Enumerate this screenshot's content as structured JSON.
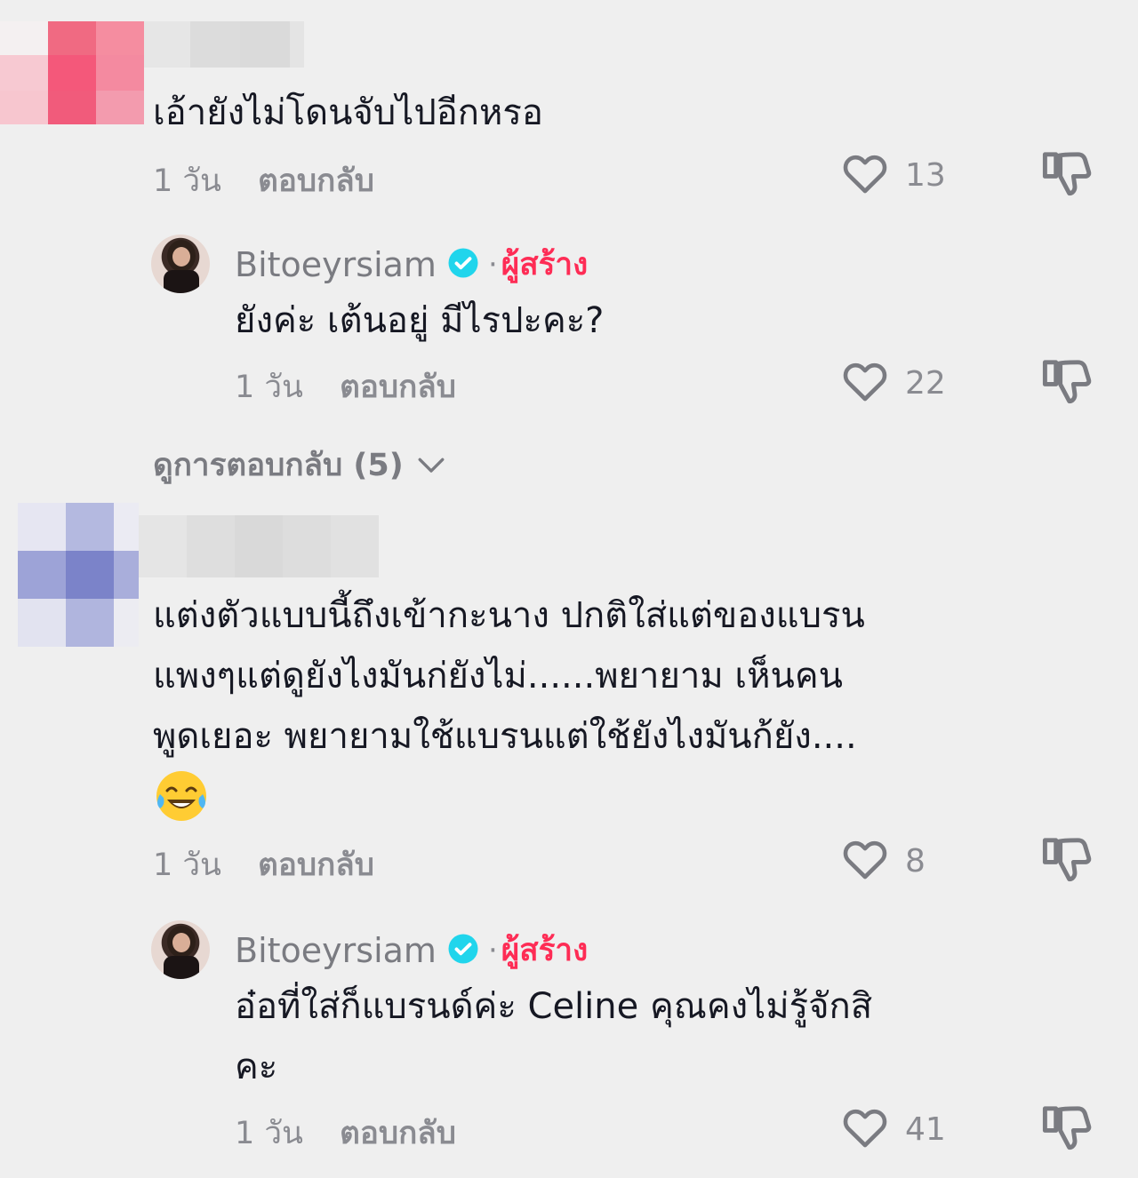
{
  "comments": [
    {
      "text_lines": [
        "เอ้ายังไม่โดนจับไปอีกหรอ"
      ],
      "time": "1 วัน",
      "reply_label": "ตอบกลับ",
      "likes": "13"
    },
    {
      "text_lines": [
        "แต่งตัวแบบนี้ถึงเข้ากะนาง ปกติใส่แต่ของแบรน",
        "แพงๆแต่ดูยังไงมันก่ยังไม่......พยายาม เห็นคน",
        "พูดเยอะ พยายามใช้แบรนแต่ใช้ยังไงมันก้ยัง...."
      ],
      "emoji": "😂",
      "time": "1 วัน",
      "reply_label": "ตอบกลับ",
      "likes": "8"
    }
  ],
  "replies": [
    {
      "username": "Bitoeyrsiam",
      "creator_label": "ผู้สร้าง",
      "text_lines": [
        "ยังค่ะ เต้นอยู่ มีไรปะคะ?"
      ],
      "time": "1 วัน",
      "reply_label": "ตอบกลับ",
      "likes": "22"
    },
    {
      "username": "Bitoeyrsiam",
      "creator_label": "ผู้สร้าง",
      "text_lines": [
        "อ๋อที่ใส่ก็แบรนด์ค่ะ Celine คุณคงไม่รู้จักสิ",
        "คะ"
      ],
      "time": "1 วัน",
      "reply_label": "ตอบกลับ",
      "likes": "41"
    }
  ],
  "view_replies": "ดูการตอบกลับ (5)",
  "icons": {
    "like": "heart-outline-icon",
    "dislike": "thumbs-down-icon",
    "verified": "verified-badge-icon",
    "expand": "chevron-down-icon"
  },
  "colors": {
    "background": "#efefef",
    "creator_tag": "#fe2c55",
    "verified": "#20d5ec",
    "meta_text": "#8a8b91"
  }
}
